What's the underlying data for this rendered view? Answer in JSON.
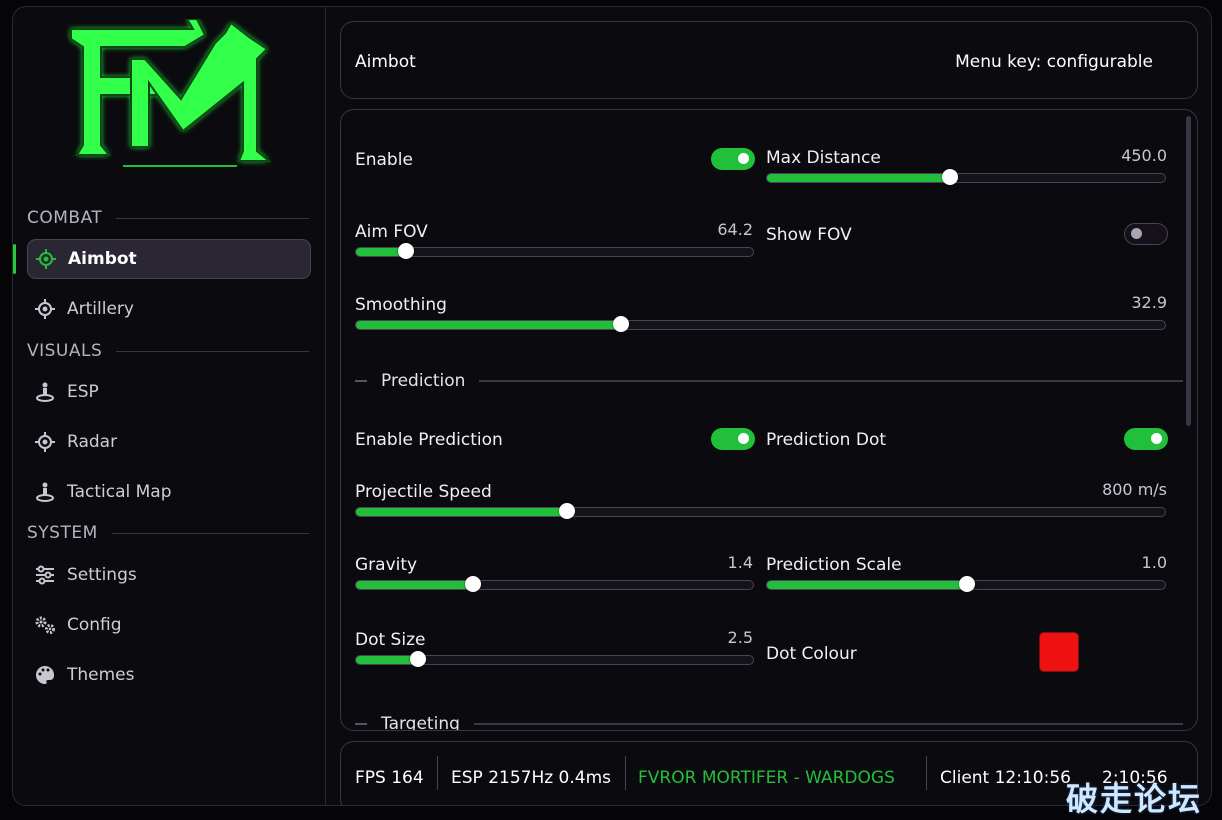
{
  "sidebar": {
    "logo_text": "FM",
    "sections": [
      {
        "title": "COMBAT"
      },
      {
        "title": "VISUALS"
      },
      {
        "title": "SYSTEM"
      }
    ],
    "items": [
      {
        "label": "Aimbot",
        "icon": "crosshair-icon",
        "active": true
      },
      {
        "label": "Artillery",
        "icon": "crosshair-icon"
      },
      {
        "label": "ESP",
        "icon": "person-icon"
      },
      {
        "label": "Radar",
        "icon": "crosshair-icon"
      },
      {
        "label": "Tactical Map",
        "icon": "person-icon"
      },
      {
        "label": "Settings",
        "icon": "sliders-icon"
      },
      {
        "label": "Config",
        "icon": "gears-icon"
      },
      {
        "label": "Themes",
        "icon": "palette-icon"
      }
    ]
  },
  "header": {
    "title": "Aimbot",
    "menu_key": "Menu key: configurable"
  },
  "settings": {
    "enable": {
      "label": "Enable",
      "on": true
    },
    "max_distance": {
      "label": "Max Distance",
      "value": "450.0",
      "fraction": 0.46
    },
    "aim_fov": {
      "label": "Aim FOV",
      "value": "64.2",
      "fraction": 0.125
    },
    "show_fov": {
      "label": "Show FOV",
      "on": false
    },
    "smoothing": {
      "label": "Smoothing",
      "value": "32.9",
      "fraction": 0.328
    },
    "prediction_section": "Prediction",
    "enable_prediction": {
      "label": "Enable Prediction",
      "on": true
    },
    "prediction_dot": {
      "label": "Prediction Dot",
      "on": true
    },
    "projectile_speed": {
      "label": "Projectile Speed",
      "value": "800 m/s",
      "fraction": 0.261
    },
    "gravity": {
      "label": "Gravity",
      "value": "1.4",
      "fraction": 0.294
    },
    "prediction_scale": {
      "label": "Prediction Scale",
      "value": "1.0",
      "fraction": 0.503
    },
    "dot_size": {
      "label": "Dot Size",
      "value": "2.5",
      "fraction": 0.156
    },
    "dot_colour": {
      "label": "Dot Colour",
      "color": "#ee1111"
    },
    "targeting_section": "Targeting"
  },
  "status": {
    "fps": "FPS 164",
    "esp": "ESP 2157Hz 0.4ms",
    "name": "FVROR MORTIFER - WARDOGS",
    "client": "Client 12:10:56",
    "time2": "2:10:56"
  },
  "watermark": "破走论坛",
  "colors": {
    "accent": "#22c03a",
    "background": "#0b0a0e",
    "border": "#3a3445"
  }
}
